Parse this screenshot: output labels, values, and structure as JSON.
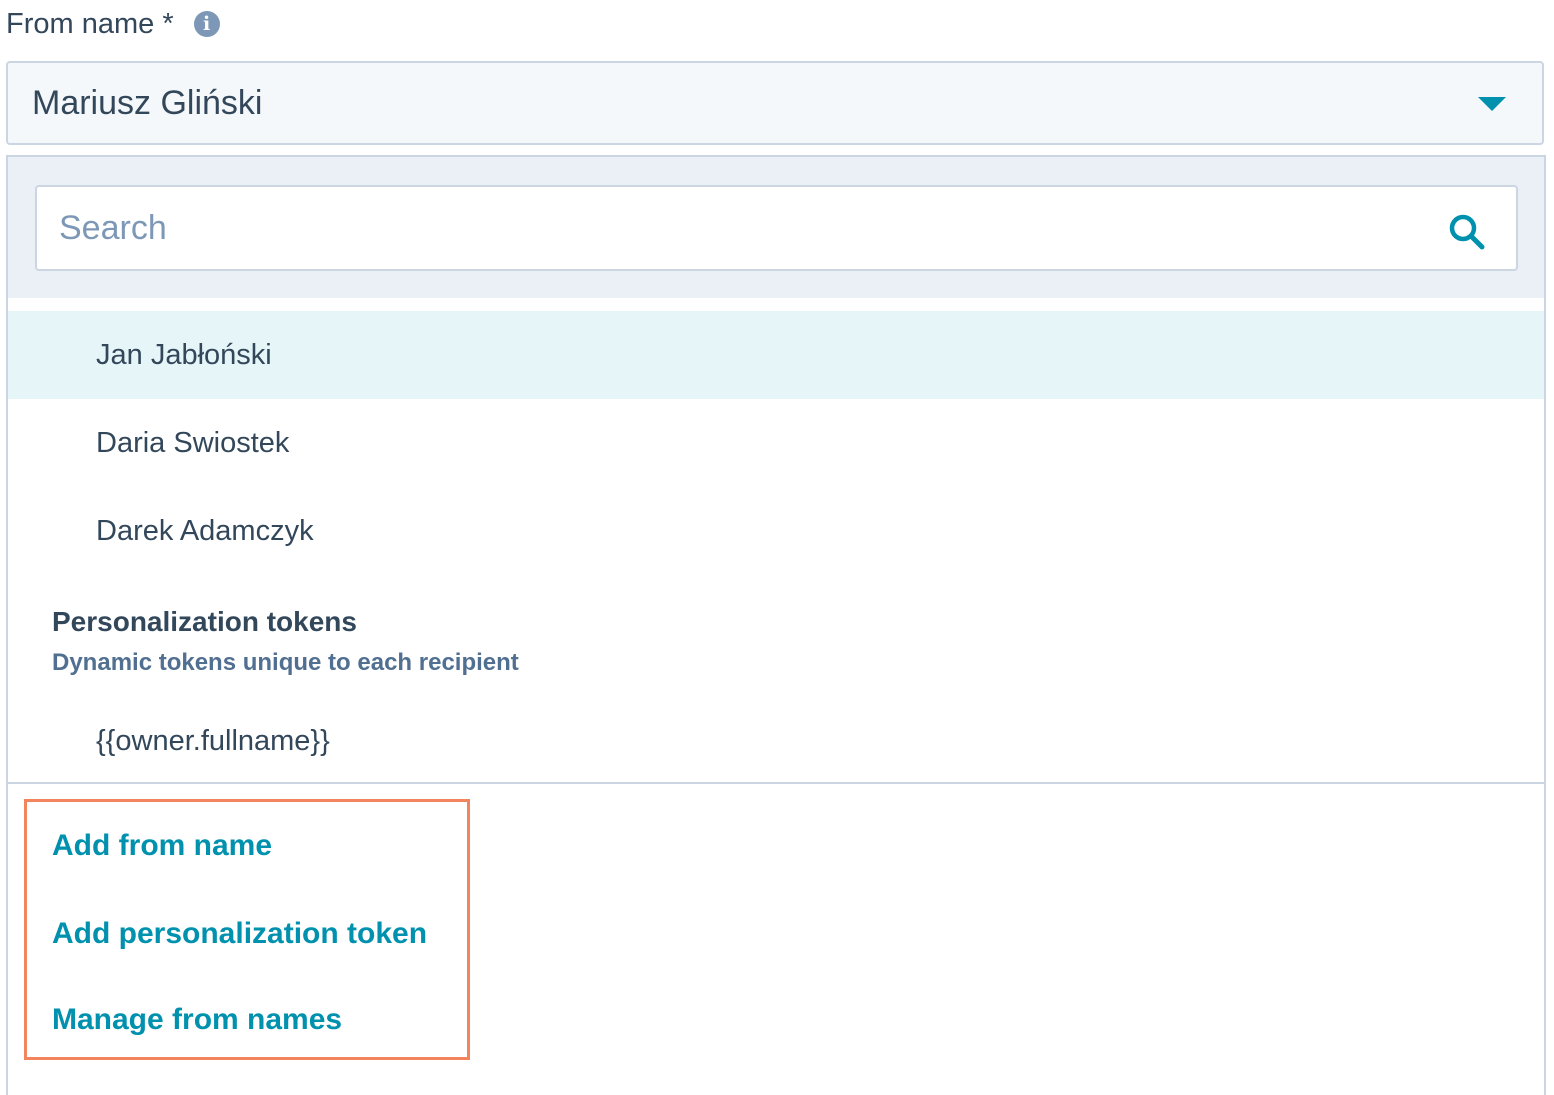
{
  "field": {
    "label": "From name *",
    "info_icon": "info-icon"
  },
  "select": {
    "selected_value": "Mariusz Gliński",
    "caret_icon": "caret-down-icon"
  },
  "search": {
    "placeholder": "Search",
    "value": "",
    "icon": "search-icon"
  },
  "options": [
    {
      "label": "Jan Jabłoński",
      "highlighted": true
    },
    {
      "label": "Daria Swiostek",
      "highlighted": false
    },
    {
      "label": "Darek Adamczyk",
      "highlighted": false
    }
  ],
  "tokens_group": {
    "title": "Personalization tokens",
    "subtitle": "Dynamic tokens unique to each recipient",
    "options": [
      {
        "label": "{{owner.fullname}}"
      }
    ]
  },
  "actions": [
    {
      "label": "Add from name"
    },
    {
      "label": "Add personalization token"
    },
    {
      "label": "Manage from names"
    }
  ],
  "colors": {
    "accent": "#0091ae",
    "highlight_row": "#e5f5f8",
    "annotation_border": "#f2855e",
    "panel_bg": "#eaf0f6",
    "border": "#cbd6e2"
  }
}
